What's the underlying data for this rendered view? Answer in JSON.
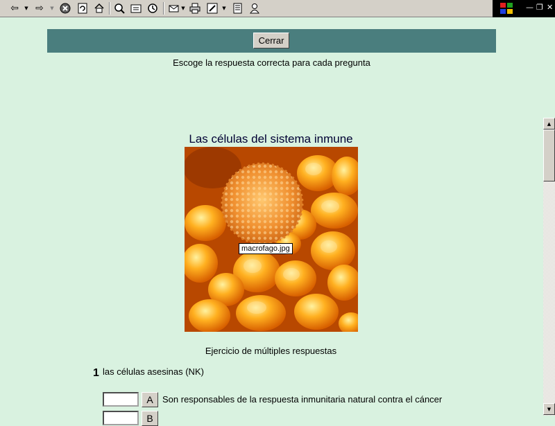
{
  "toolbar": {
    "icons": [
      "back-icon",
      "forward-icon",
      "stop-icon",
      "refresh-icon",
      "home-icon",
      "search-icon",
      "favorites-icon",
      "history-icon",
      "mail-icon",
      "print-icon",
      "edit-icon",
      "discuss-icon",
      "messenger-icon"
    ]
  },
  "header": {
    "close_label": "Cerrar"
  },
  "instruction": "Escoge la respuesta correcta para cada pregunta",
  "page_title": "Las células del sistema inmune",
  "image": {
    "tooltip": "macrofago.jpg"
  },
  "exercise_title": "Ejercicio de múltiples respuestas",
  "question": {
    "number": "1",
    "text": "las células asesinas (NK)",
    "answers": [
      {
        "letter": "A",
        "text": "Son responsables de la respuesta inmunitaria natural contra el cáncer",
        "value": ""
      },
      {
        "letter": "B",
        "text": "",
        "value": ""
      }
    ]
  },
  "colors": {
    "page_background": "#d9f2e0",
    "header_bar": "#4a7e7e",
    "title_text": "#000033"
  }
}
